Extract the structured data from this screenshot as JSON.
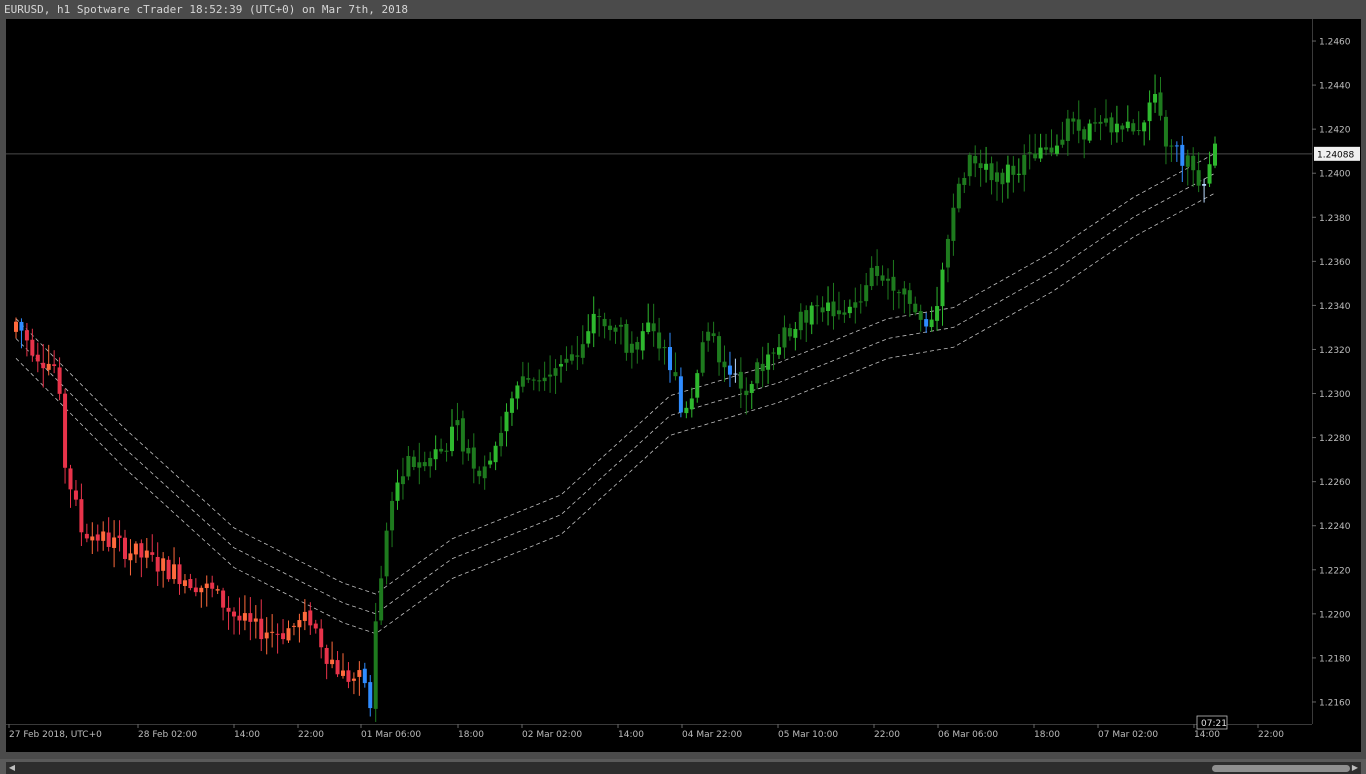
{
  "window": {
    "title": "EURUSD, h1 Spotware cTrader 18:52:39 (UTC+0) on Mar 7th, 2018"
  },
  "colors": {
    "background": "#000000",
    "bull": "#2eb82e",
    "bull_dark": "#1e7a1e",
    "bear": "#e8334a",
    "bear_orange": "#ff6a3d",
    "blue": "#2f8cff",
    "pale_blue": "#b8d8ff",
    "band": "#bfbfbf",
    "axis_text": "#bdbdbd",
    "price_line": "#4a4a4a"
  },
  "chart_data": {
    "type": "candlestick",
    "symbol": "EURUSD",
    "timeframe": "h1",
    "y_axis": {
      "ticks": [
        "1.2460",
        "1.2440",
        "1.2420",
        "1.2400",
        "1.2380",
        "1.2360",
        "1.2340",
        "1.2320",
        "1.2300",
        "1.2280",
        "1.2260",
        "1.2240",
        "1.2220",
        "1.2200",
        "1.2180",
        "1.2160"
      ],
      "ylim": [
        1.215,
        1.247
      ]
    },
    "x_axis": {
      "ticks": [
        "27 Feb 2018, UTC+0",
        "28 Feb 02:00",
        "14:00",
        "22:00",
        "01 Mar 06:00",
        "18:00",
        "02 Mar 02:00",
        "14:00",
        "04 Mar 22:00",
        "05 Mar 10:00",
        "22:00",
        "06 Mar 06:00",
        "18:00",
        "07 Mar 02:00",
        "14:00",
        "22:00"
      ],
      "cursor_label": "07:21"
    },
    "current_price": "1.24088",
    "anchors": [
      [
        0,
        1.2332
      ],
      [
        4,
        1.2318
      ],
      [
        7,
        1.2312
      ],
      [
        8,
        1.2295
      ],
      [
        9,
        1.2268
      ],
      [
        12,
        1.2238
      ],
      [
        18,
        1.2232
      ],
      [
        24,
        1.2225
      ],
      [
        30,
        1.2218
      ],
      [
        36,
        1.221
      ],
      [
        41,
        1.2197
      ],
      [
        44,
        1.2193
      ],
      [
        49,
        1.2192
      ],
      [
        54,
        1.2198
      ],
      [
        57,
        1.2182
      ],
      [
        60,
        1.2172
      ],
      [
        63,
        1.217
      ],
      [
        66,
        1.22
      ],
      [
        69,
        1.2255
      ],
      [
        72,
        1.2268
      ],
      [
        78,
        1.2275
      ],
      [
        81,
        1.2283
      ],
      [
        85,
        1.2265
      ],
      [
        88,
        1.2278
      ],
      [
        90,
        1.229
      ],
      [
        93,
        1.2305
      ],
      [
        97,
        1.2312
      ],
      [
        101,
        1.2315
      ],
      [
        104,
        1.2325
      ],
      [
        107,
        1.2338
      ],
      [
        110,
        1.233
      ],
      [
        113,
        1.232
      ],
      [
        116,
        1.2328
      ],
      [
        118,
        1.2322
      ],
      [
        120,
        1.2318
      ],
      [
        122,
        1.2292
      ],
      [
        124,
        1.23
      ],
      [
        126,
        1.2325
      ],
      [
        128,
        1.2322
      ],
      [
        130,
        1.2315
      ],
      [
        133,
        1.23
      ],
      [
        136,
        1.231
      ],
      [
        139,
        1.2322
      ],
      [
        142,
        1.2328
      ],
      [
        145,
        1.2335
      ],
      [
        148,
        1.234
      ],
      [
        151,
        1.2336
      ],
      [
        154,
        1.234
      ],
      [
        157,
        1.2355
      ],
      [
        160,
        1.2353
      ],
      [
        163,
        1.2348
      ],
      [
        165,
        1.2337
      ],
      [
        167,
        1.233
      ],
      [
        169,
        1.2342
      ],
      [
        171,
        1.2366
      ],
      [
        173,
        1.2395
      ],
      [
        176,
        1.2408
      ],
      [
        180,
        1.2398
      ],
      [
        183,
        1.2402
      ],
      [
        186,
        1.2406
      ],
      [
        189,
        1.2408
      ],
      [
        192,
        1.242
      ],
      [
        196,
        1.242
      ],
      [
        199,
        1.242
      ],
      [
        202,
        1.2422
      ],
      [
        205,
        1.2418
      ],
      [
        207,
        1.2426
      ],
      [
        209,
        1.2432
      ],
      [
        211,
        1.2412
      ],
      [
        213,
        1.241
      ],
      [
        215,
        1.2404
      ],
      [
        217,
        1.2398
      ],
      [
        219,
        1.2402
      ],
      [
        220,
        1.241
      ]
    ],
    "special_candles": {
      "blue_bear": [
        1,
        64,
        65,
        120,
        122,
        131,
        167,
        213,
        214
      ],
      "pale_bull": [
        132,
        218
      ]
    },
    "band_points": [
      [
        0,
        1.2325
      ],
      [
        20,
        1.2275
      ],
      [
        40,
        1.223
      ],
      [
        60,
        1.2205
      ],
      [
        66,
        1.22
      ],
      [
        80,
        1.2225
      ],
      [
        100,
        1.2245
      ],
      [
        120,
        1.229
      ],
      [
        140,
        1.2305
      ],
      [
        160,
        1.2325
      ],
      [
        172,
        1.233
      ],
      [
        190,
        1.2355
      ],
      [
        205,
        1.238
      ],
      [
        220,
        1.24
      ]
    ],
    "band_offset": 0.0009
  }
}
